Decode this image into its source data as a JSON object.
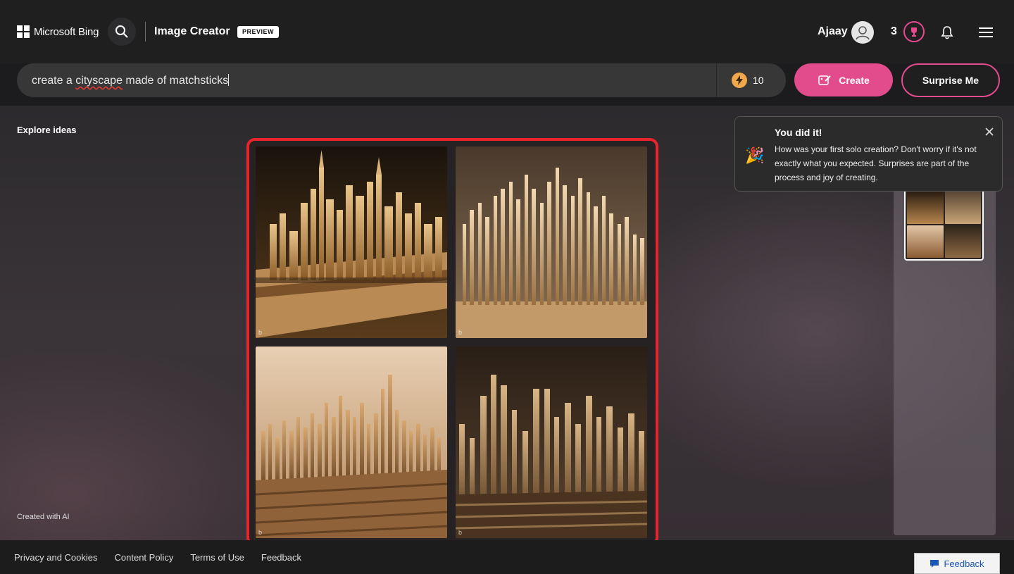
{
  "header": {
    "brand": "Microsoft Bing",
    "app_title": "Image Creator",
    "badge": "PREVIEW",
    "user_name": "Ajaay",
    "reward_count": "3"
  },
  "prompt": {
    "value_prefix": "create a ",
    "value_misspelled": "cityscape",
    "value_suffix": " made of matchsticks",
    "boost_count": "10",
    "create_label": "Create",
    "surprise_label": "Surprise Me"
  },
  "main": {
    "explore_label": "Explore ideas",
    "created_with_ai": "Created with AI",
    "images": [
      {
        "name": "matchstick city 1"
      },
      {
        "name": "matchstick city 2"
      },
      {
        "name": "matchstick city 3"
      },
      {
        "name": "matchstick city 4"
      }
    ]
  },
  "toast": {
    "title": "You did it!",
    "body": "How was your first solo creation? Don't worry if it's not exactly what you expected. Surprises are part of the process and joy of creating.",
    "icon": "party-popper-icon"
  },
  "footer": {
    "links": [
      "Privacy and Cookies",
      "Content Policy",
      "Terms of Use",
      "Feedback"
    ],
    "feedback_button": "Feedback"
  },
  "colors": {
    "accent": "#e24b8c",
    "highlight_frame": "#e8242c"
  }
}
